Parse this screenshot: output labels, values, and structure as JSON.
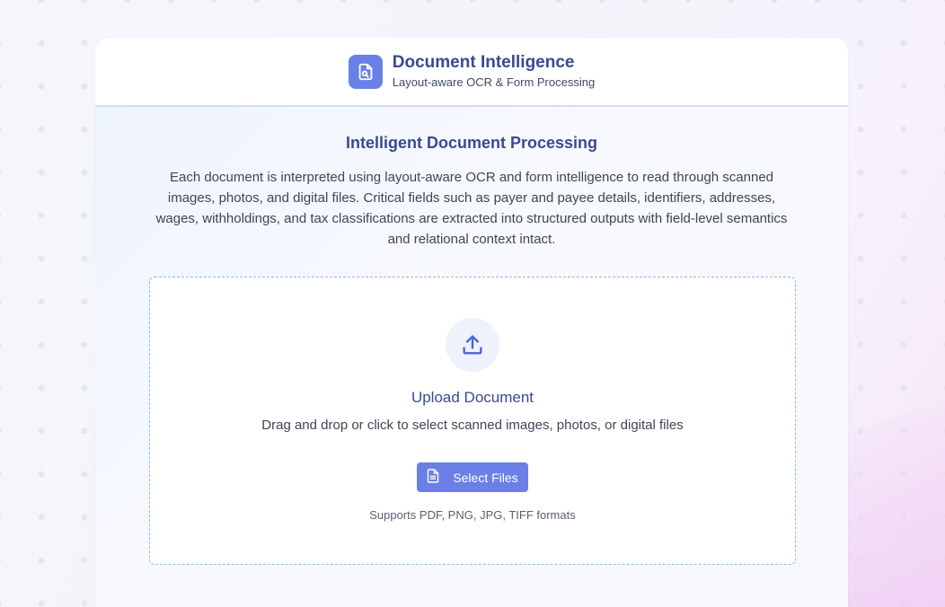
{
  "header": {
    "title": "Document Intelligence",
    "subtitle": "Layout-aware OCR & Form Processing",
    "logo_icon": "document-search-icon"
  },
  "main": {
    "title": "Intelligent Document Processing",
    "description": "Each document is interpreted using layout-aware OCR and form intelligence to read through scanned images, photos, and digital files. Critical fields such as payer and payee details, identifiers, addresses, wages, withholdings, and tax classifications are extracted into structured outputs with field-level semantics and relational context intact."
  },
  "upload": {
    "icon": "upload-icon",
    "title": "Upload Document",
    "description": "Drag and drop or click to select scanned images, photos, or digital files",
    "button_label": "Select Files",
    "button_icon": "file-icon",
    "formats": "Supports PDF, PNG, JPG, TIFF formats"
  },
  "colors": {
    "accent": "#6a80e6",
    "heading": "#3a4a8f",
    "dropzone_border": "#8fb9ec"
  }
}
